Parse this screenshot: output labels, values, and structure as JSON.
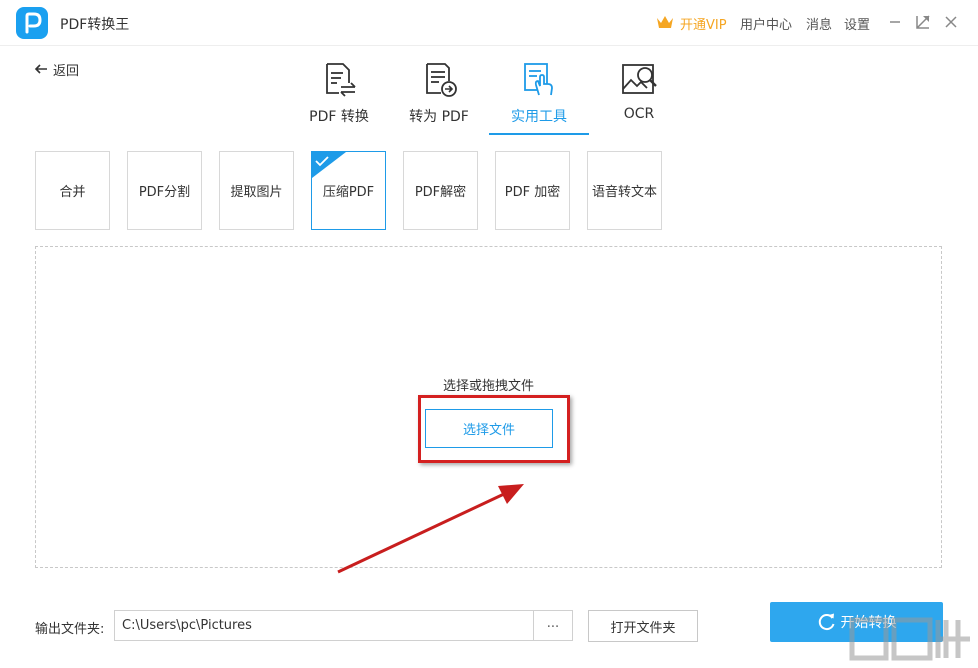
{
  "app": {
    "title": "PDF转换王"
  },
  "titlebar": {
    "vip_label": "开通VIP",
    "user_center": "用户中心",
    "messages": "消息",
    "settings": "设置"
  },
  "nav": {
    "back_label": "返回"
  },
  "tabs": [
    {
      "label": "PDF 转换",
      "icon": "pdf-convert-icon"
    },
    {
      "label": "转为 PDF",
      "icon": "to-pdf-icon"
    },
    {
      "label": "实用工具",
      "icon": "tools-icon",
      "active": true
    },
    {
      "label": "OCR",
      "icon": "ocr-icon"
    }
  ],
  "tools": [
    {
      "label": "合并"
    },
    {
      "label": "PDF分割"
    },
    {
      "label": "提取图片"
    },
    {
      "label": "压缩PDF",
      "selected": true
    },
    {
      "label": "PDF解密"
    },
    {
      "label": "PDF 加密"
    },
    {
      "label": "语音转文本"
    }
  ],
  "dropzone": {
    "hint": "选择或拖拽文件",
    "select_button": "选择文件"
  },
  "bottom": {
    "output_label": "输出文件夹:",
    "output_path": "C:\\Users\\pc\\Pictures",
    "browse_label": "...",
    "open_folder": "打开文件夹",
    "start_label": "开始转换"
  },
  "colors": {
    "accent": "#1e9be8",
    "vip": "#f5a623",
    "annotation": "#d42020"
  }
}
